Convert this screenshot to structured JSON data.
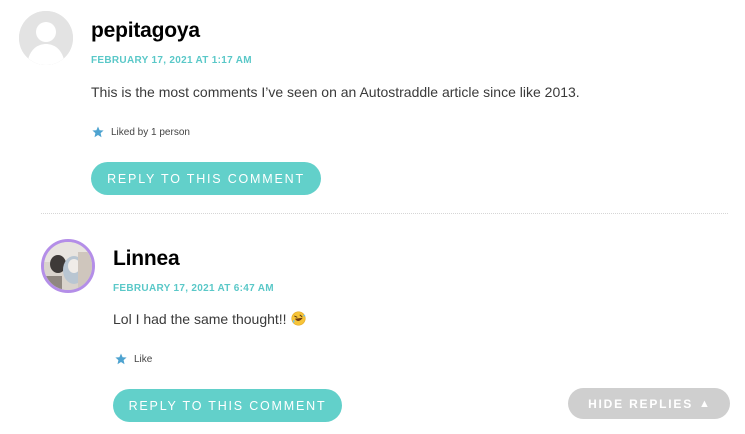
{
  "comment": {
    "author": "pepitagoya",
    "date": "FEBRUARY 17, 2021 AT 1:17 AM",
    "text": "This is the most comments I’ve seen on an Autostraddle article since like 2013.",
    "likes": "Liked by 1 person",
    "reply_label": "REPLY TO THIS COMMENT",
    "avatar_icon": "default-avatar-icon"
  },
  "reply": {
    "author": "Linnea",
    "date": "FEBRUARY 17, 2021 AT 6:47 AM",
    "text": "Lol I had the same thought!!",
    "emoji": "rofl-emoji-icon",
    "likes": "Like",
    "reply_label": "REPLY TO THIS COMMENT"
  },
  "hide_replies_label": "HIDE REPLIES",
  "colors": {
    "accent": "#62d0ca",
    "date": "#5ac8c8",
    "avatar_ring": "#b48ee8",
    "hide_button": "#cfcfcf",
    "star": "#4ea3d0"
  }
}
